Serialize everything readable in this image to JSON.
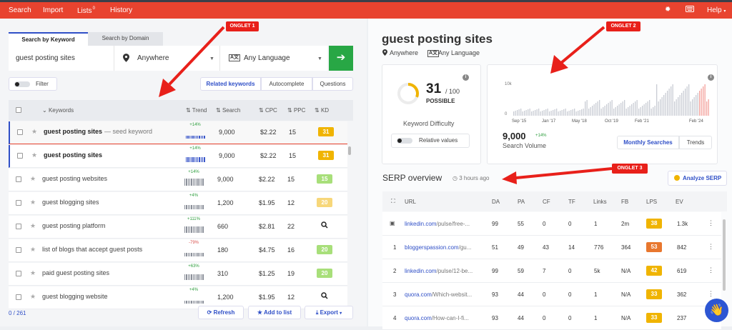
{
  "topbar": {
    "search": "Search",
    "import": "Import",
    "lists": "Lists",
    "lists_badge": "0",
    "history": "History",
    "help": "Help"
  },
  "search": {
    "tab_keyword": "Search by Keyword",
    "tab_domain": "Search by Domain",
    "keyword": "guest posting sites",
    "location": "Anywhere",
    "language": "Any Language"
  },
  "filter": {
    "label": "Filter",
    "related": "Related keywords",
    "autocomplete": "Autocomplete",
    "questions": "Questions"
  },
  "table": {
    "headers": [
      "Keywords",
      "Trend",
      "Search",
      "CPC",
      "PPC",
      "KD"
    ],
    "rows": [
      {
        "keyword": "guest posting sites",
        "seed": "— seed keyword",
        "trend": "+14%",
        "search": "9,000",
        "cpc": "$2.22",
        "ppc": "15",
        "kd": "31"
      },
      {
        "keyword": "guest posting sites",
        "trend": "+14%",
        "search": "9,000",
        "cpc": "$2.22",
        "ppc": "15",
        "kd": "31"
      },
      {
        "keyword": "guest posting websites",
        "trend": "+14%",
        "search": "9,000",
        "cpc": "$2.22",
        "ppc": "15",
        "kd": "15"
      },
      {
        "keyword": "guest blogging sites",
        "trend": "+4%",
        "search": "1,200",
        "cpc": "$1.95",
        "ppc": "12",
        "kd": "20"
      },
      {
        "keyword": "guest posting platform",
        "trend": "+111%",
        "search": "660",
        "cpc": "$2.81",
        "ppc": "22",
        "kd": ""
      },
      {
        "keyword": "list of blogs that accept guest posts",
        "trend": "-79%",
        "search": "180",
        "cpc": "$4.75",
        "ppc": "16",
        "kd": "20"
      },
      {
        "keyword": "paid guest posting sites",
        "trend": "+63%",
        "search": "310",
        "cpc": "$1.25",
        "ppc": "19",
        "kd": "20"
      },
      {
        "keyword": "guest blogging website",
        "trend": "+4%",
        "search": "1,200",
        "cpc": "$1.95",
        "ppc": "12",
        "kd": ""
      }
    ]
  },
  "footer": {
    "count": "0 / 261",
    "refresh": "Refresh",
    "add": "Add to list",
    "export": "Export"
  },
  "overview": {
    "title": "guest posting sites",
    "location": "Anywhere",
    "language": "Any Language",
    "kd_value": "31",
    "kd_max": "/ 100",
    "kd_label": "POSSIBLE",
    "kd_caption": "Keyword Difficulty",
    "relative": "Relative values",
    "volume": "9,000",
    "volume_change": "+14%",
    "volume_label": "Search Volume",
    "monthly": "Monthly Searches",
    "trends": "Trends",
    "y_ticks": [
      "10k",
      "0"
    ],
    "x_ticks": [
      "Sep '15",
      "Jan '17",
      "May '18",
      "Oct '19",
      "Feb '21",
      "Feb '24"
    ]
  },
  "serp": {
    "title": "SERP overview",
    "ago": "3 hours ago",
    "analyze": "Analyze SERP",
    "headers": [
      "URL",
      "DA",
      "PA",
      "CF",
      "TF",
      "Links",
      "FB",
      "LPS",
      "EV"
    ],
    "rows": [
      {
        "n": "",
        "domain": "linkedin.com",
        "path": "/pulse/free-...",
        "da": "99",
        "pa": "55",
        "cf": "0",
        "tf": "0",
        "links": "1",
        "fb": "2m",
        "lps": "38",
        "ev": "1.3k"
      },
      {
        "n": "1",
        "domain": "bloggerspassion.com",
        "path": "/gu...",
        "da": "51",
        "pa": "49",
        "cf": "43",
        "tf": "14",
        "links": "776",
        "fb": "364",
        "lps": "53",
        "ev": "842"
      },
      {
        "n": "2",
        "domain": "linkedin.com",
        "path": "/pulse/12-be...",
        "da": "99",
        "pa": "59",
        "cf": "7",
        "tf": "0",
        "links": "5k",
        "fb": "N/A",
        "lps": "42",
        "ev": "619"
      },
      {
        "n": "3",
        "domain": "quora.com",
        "path": "/Which-websit...",
        "da": "93",
        "pa": "44",
        "cf": "0",
        "tf": "0",
        "links": "1",
        "fb": "N/A",
        "lps": "33",
        "ev": "362"
      },
      {
        "n": "4",
        "domain": "quora.com",
        "path": "/How-can-I-fi...",
        "da": "93",
        "pa": "44",
        "cf": "0",
        "tf": "0",
        "links": "1",
        "fb": "N/A",
        "lps": "33",
        "ev": "237"
      }
    ]
  },
  "annotations": {
    "a1": "ONGLET 1",
    "a2": "ONGLET 2",
    "a3": "ONGLET 3"
  },
  "colors": {
    "topbar": "#e8432f",
    "accent": "#2f4fc7",
    "go": "#28a745",
    "kd_orange": "#f0b400",
    "kd_green": "#a8df7a",
    "kd_yellow": "#f7d77a",
    "arrow": "#e8201a"
  }
}
